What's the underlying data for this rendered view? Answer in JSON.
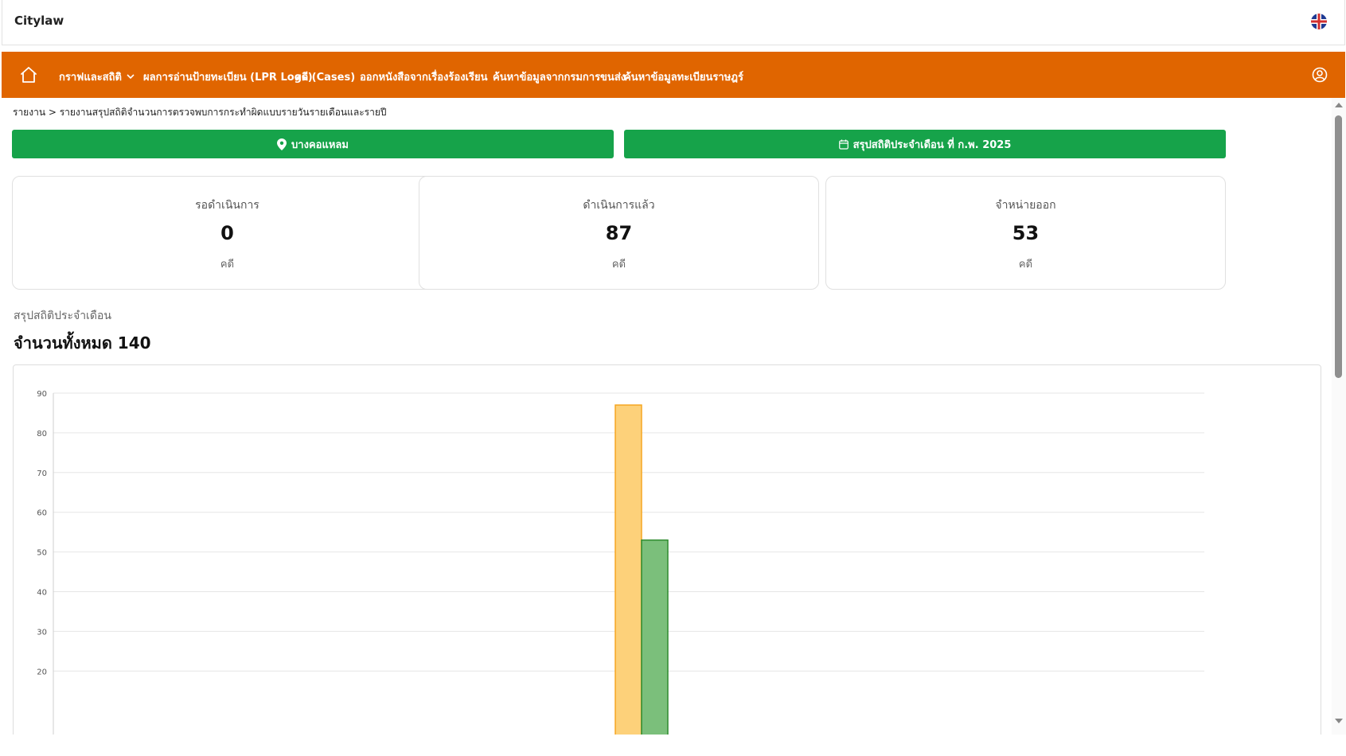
{
  "app": {
    "brand": "Citylaw"
  },
  "header": {
    "language_icon": "uk-flag-icon"
  },
  "navbar": {
    "home_icon": "home-icon",
    "items": [
      {
        "label": "กราฟและสถิติ",
        "has_dropdown": true
      },
      {
        "label": "ผลการอ่านป้ายทะเบียน (LPR Logs)"
      },
      {
        "label": "คดี (Cases)"
      },
      {
        "label": "ออกหนังสือจากเรื่องร้องเรียน"
      },
      {
        "label": "ค้นหาข้อมูลจากกรมการขนส่ง"
      },
      {
        "label": "ค้นหาข้อมูลทะเบียนราษฎร์"
      }
    ],
    "user_icon": "user-circle-icon",
    "background": "#e06500"
  },
  "breadcrumb": "รายงาน > รายงานสรุปสถิติจำนวนการตรวจพบการกระทำผิดแบบรายวันรายเดือนและรายปี",
  "filters": {
    "location": {
      "label": "บางคอแหลม",
      "icon": "map-pin-icon"
    },
    "period": {
      "label": "สรุปสถิติประจำเดือน ที่ ก.พ. 2025",
      "icon": "calendar-icon"
    },
    "color": "#16a34a"
  },
  "stats": [
    {
      "label": "รอดำเนินการ",
      "value": "0",
      "unit": "คดี"
    },
    {
      "label": "ดำเนินการแล้ว",
      "value": "87",
      "unit": "คดี"
    },
    {
      "label": "จำหน่ายออก",
      "value": "53",
      "unit": "คดี"
    }
  ],
  "summary": {
    "subtitle": "สรุปสถิติประจำเดือน",
    "total_label": "จำนวนทั้งหมด 140"
  },
  "chart_data": {
    "type": "bar",
    "ylim": [
      0,
      90
    ],
    "yticks": [
      20,
      30,
      40,
      50,
      60,
      70,
      80,
      90
    ],
    "grid": true,
    "series": [
      {
        "values": [
          87
        ],
        "color": "#fdd17a",
        "border": "#f5a623"
      },
      {
        "values": [
          53
        ],
        "color": "#7bbf7b",
        "border": "#2e8b2e"
      }
    ]
  },
  "scrollbar": {
    "up_icon": "scroll-up-arrow",
    "down_icon": "scroll-down-arrow"
  }
}
